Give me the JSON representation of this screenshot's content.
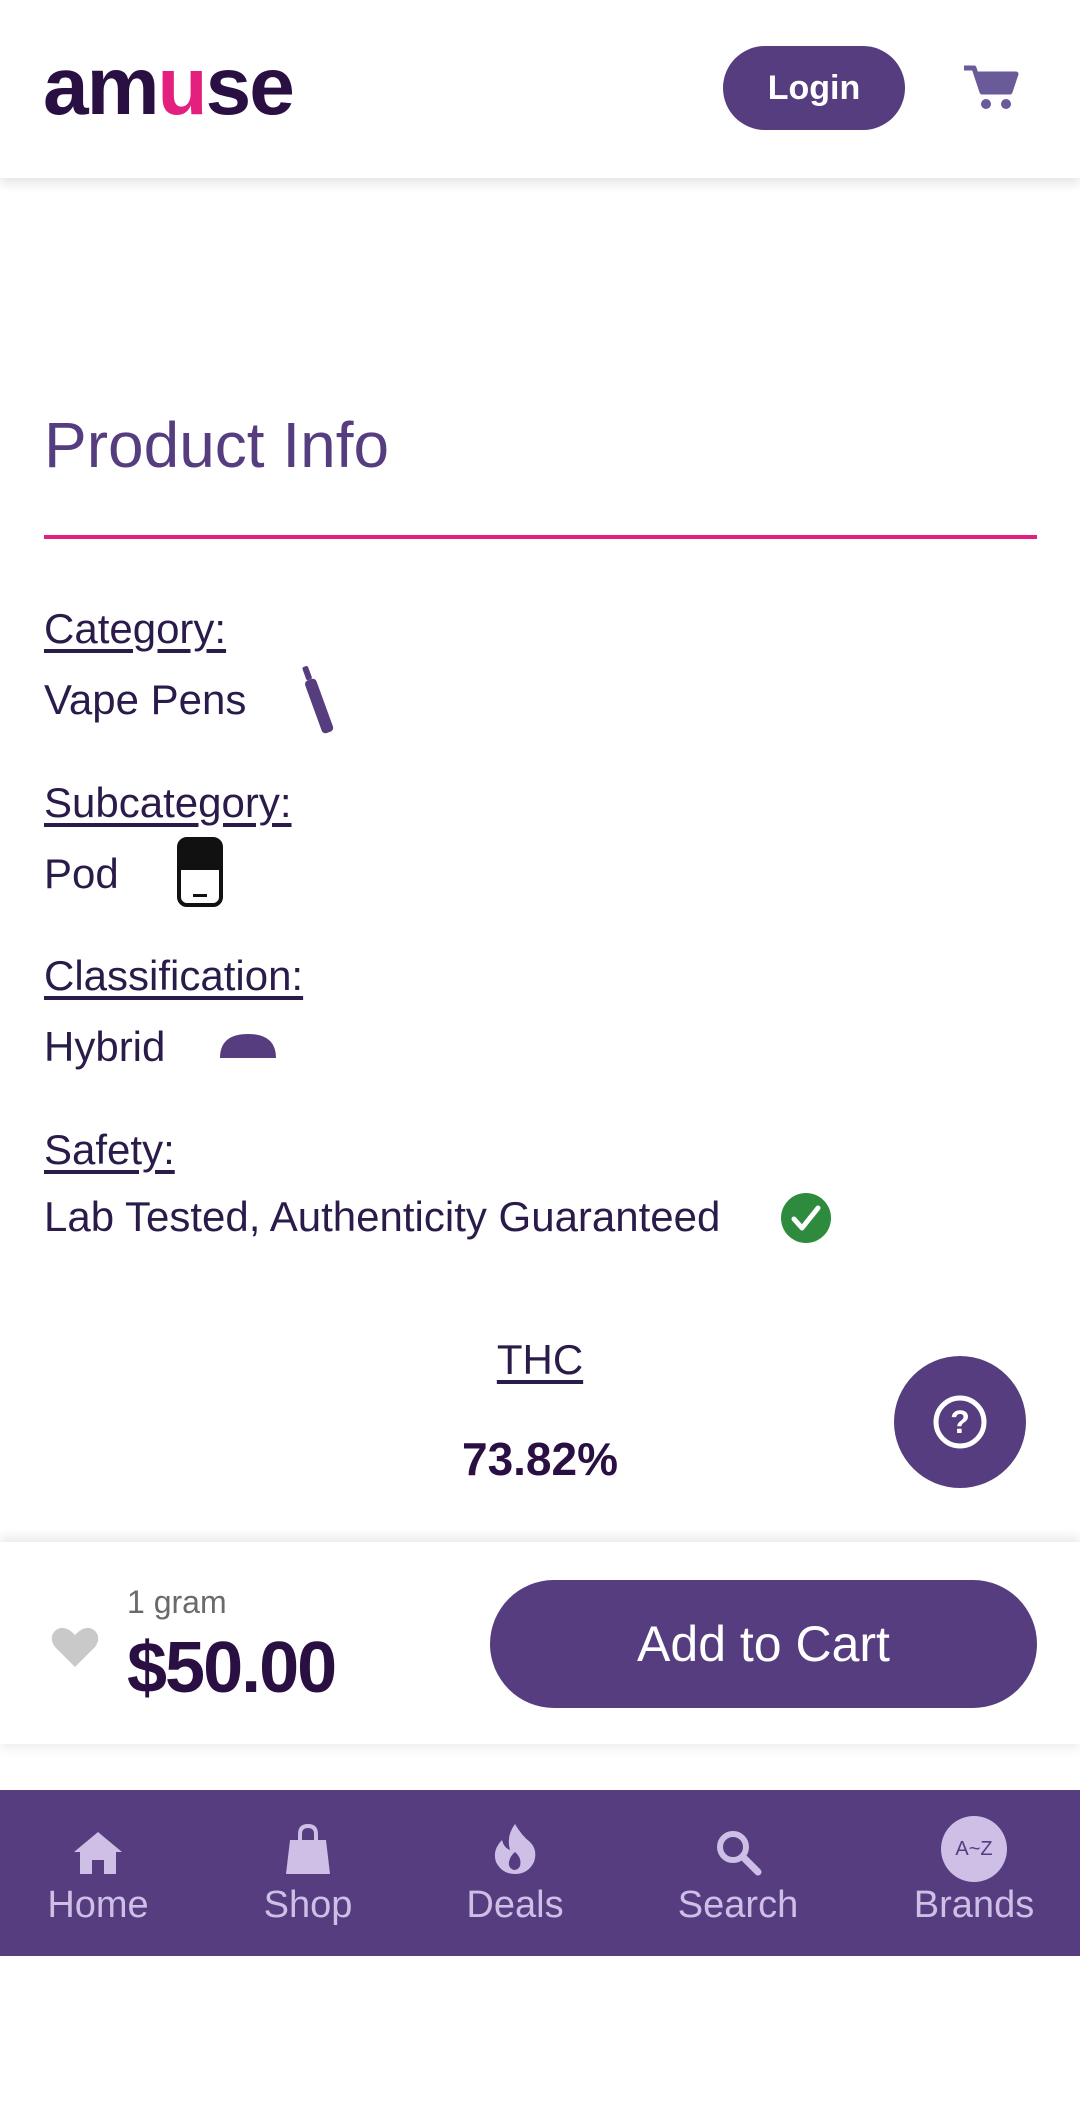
{
  "header": {
    "logo": {
      "left": "am",
      "smile": "u",
      "right": "se"
    },
    "login_label": "Login"
  },
  "product_info": {
    "title": "Product Info",
    "category": {
      "label": "Category:",
      "value": "Vape Pens"
    },
    "subcategory": {
      "label": "Subcategory:",
      "value": "Pod"
    },
    "classification": {
      "label": "Classification:",
      "value": "Hybrid"
    },
    "safety": {
      "label": "Safety:",
      "value": "Lab Tested, Authenticity Guaranteed"
    },
    "thc": {
      "label": "THC",
      "value": "73.82%"
    }
  },
  "purchase": {
    "unit": "1 gram",
    "price": "$50.00",
    "add_to_cart_label": "Add to Cart"
  },
  "nav": {
    "items": [
      {
        "label": "Home",
        "icon": "home-icon"
      },
      {
        "label": "Shop",
        "icon": "shopping-bag-icon"
      },
      {
        "label": "Deals",
        "icon": "flame-icon"
      },
      {
        "label": "Search",
        "icon": "search-icon"
      },
      {
        "label": "Brands",
        "icon": "a-z-icon",
        "badge": "A~Z"
      }
    ]
  },
  "colors": {
    "brand_purple": "#553d80",
    "accent_pink": "#e4207e",
    "dark_text": "#2a0f43",
    "check_green": "#2e8b3e",
    "nav_text": "#cdbfe6"
  }
}
